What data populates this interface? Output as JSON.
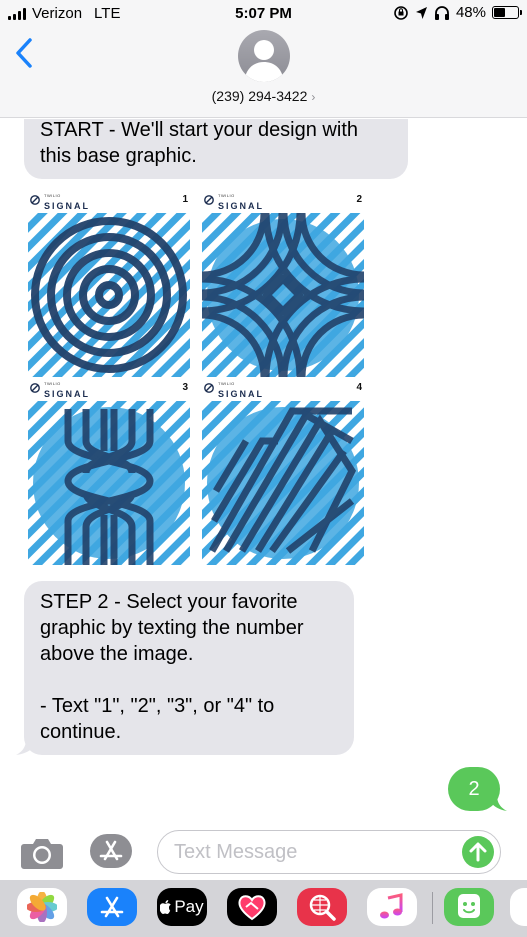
{
  "status_bar": {
    "carrier": "Verizon",
    "network": "LTE",
    "time": "5:07 PM",
    "battery_percent": "48%",
    "battery_level": 0.48
  },
  "header": {
    "contact": "(239) 294-3422",
    "chevron": "›"
  },
  "messages": {
    "start_text": "START - We'll start your design with this base graphic.",
    "step2_text": "STEP 2 - Select your favorite graphic by texting the number above the image.\n\n- Text \"1\", \"2\", \"3\", or \"4\" to continue.",
    "sent_text": "2"
  },
  "images": {
    "brand_small": "TWILIO",
    "brand": "SIGNAL",
    "tiles": [
      {
        "number": "1"
      },
      {
        "number": "2"
      },
      {
        "number": "3"
      },
      {
        "number": "4"
      }
    ]
  },
  "input_bar": {
    "placeholder": "Text Message"
  },
  "apps": {
    "applepay_label": "Pay"
  },
  "colors": {
    "tile_blue": "#3fa7e1",
    "tile_navy": "#22426b",
    "bubble_gray": "#e5e5ea",
    "sent_green": "#5ac85a",
    "ios_blue": "#1a82fb"
  }
}
